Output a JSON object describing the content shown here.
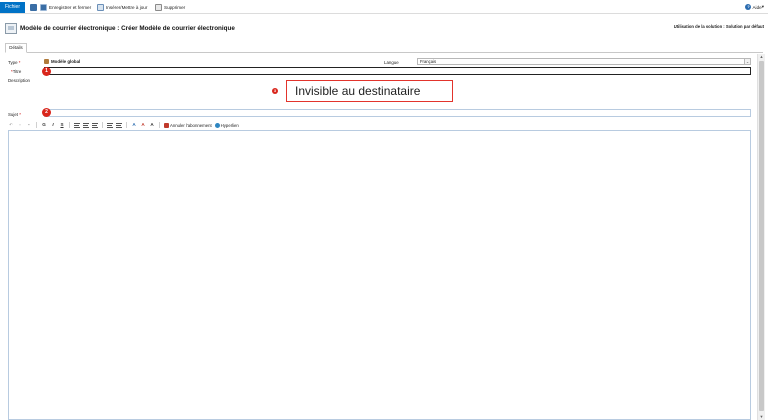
{
  "ribbon": {
    "file_label": "Fichier",
    "save_close_label": "Enregistrer et fermer",
    "insert_update_label": "Insérer/Mettre à jour",
    "delete_label": "Supprimer",
    "help_label": "Aide",
    "help_glyph": "?",
    "help_chevron": "▾",
    "accent_color": "#0072c6"
  },
  "header": {
    "title": "Modèle de courrier électronique : Créer Modèle de courrier électronique",
    "solution": "Utilisation de la solution : Solution par défaut"
  },
  "tabs": [
    {
      "label": "Détails"
    }
  ],
  "form": {
    "type_label": "Type",
    "type_value": "Modèle global",
    "required_mark": "*",
    "language_label": "Langue",
    "language_value": "Français",
    "language_arrow": "⌄",
    "title_label": "Titre",
    "description_label": "Description",
    "subject_label": "Sujet",
    "callout_text": "Invisible au destinataire",
    "badges": [
      "1",
      "2",
      "3"
    ]
  },
  "toolbar": {
    "bold": "G",
    "italic": "I",
    "underline": "S",
    "undo_glyph": "↶",
    "unsubscribe_label": "Annuler l'abonnement",
    "hyperlink_label": "Hyperlien",
    "font_color_glyph": "A",
    "font_size_glyph": "A",
    "font_size_up_glyph": "A",
    "chevron": "▾"
  },
  "scrollbar": {
    "up": "▲",
    "down": "▼"
  }
}
